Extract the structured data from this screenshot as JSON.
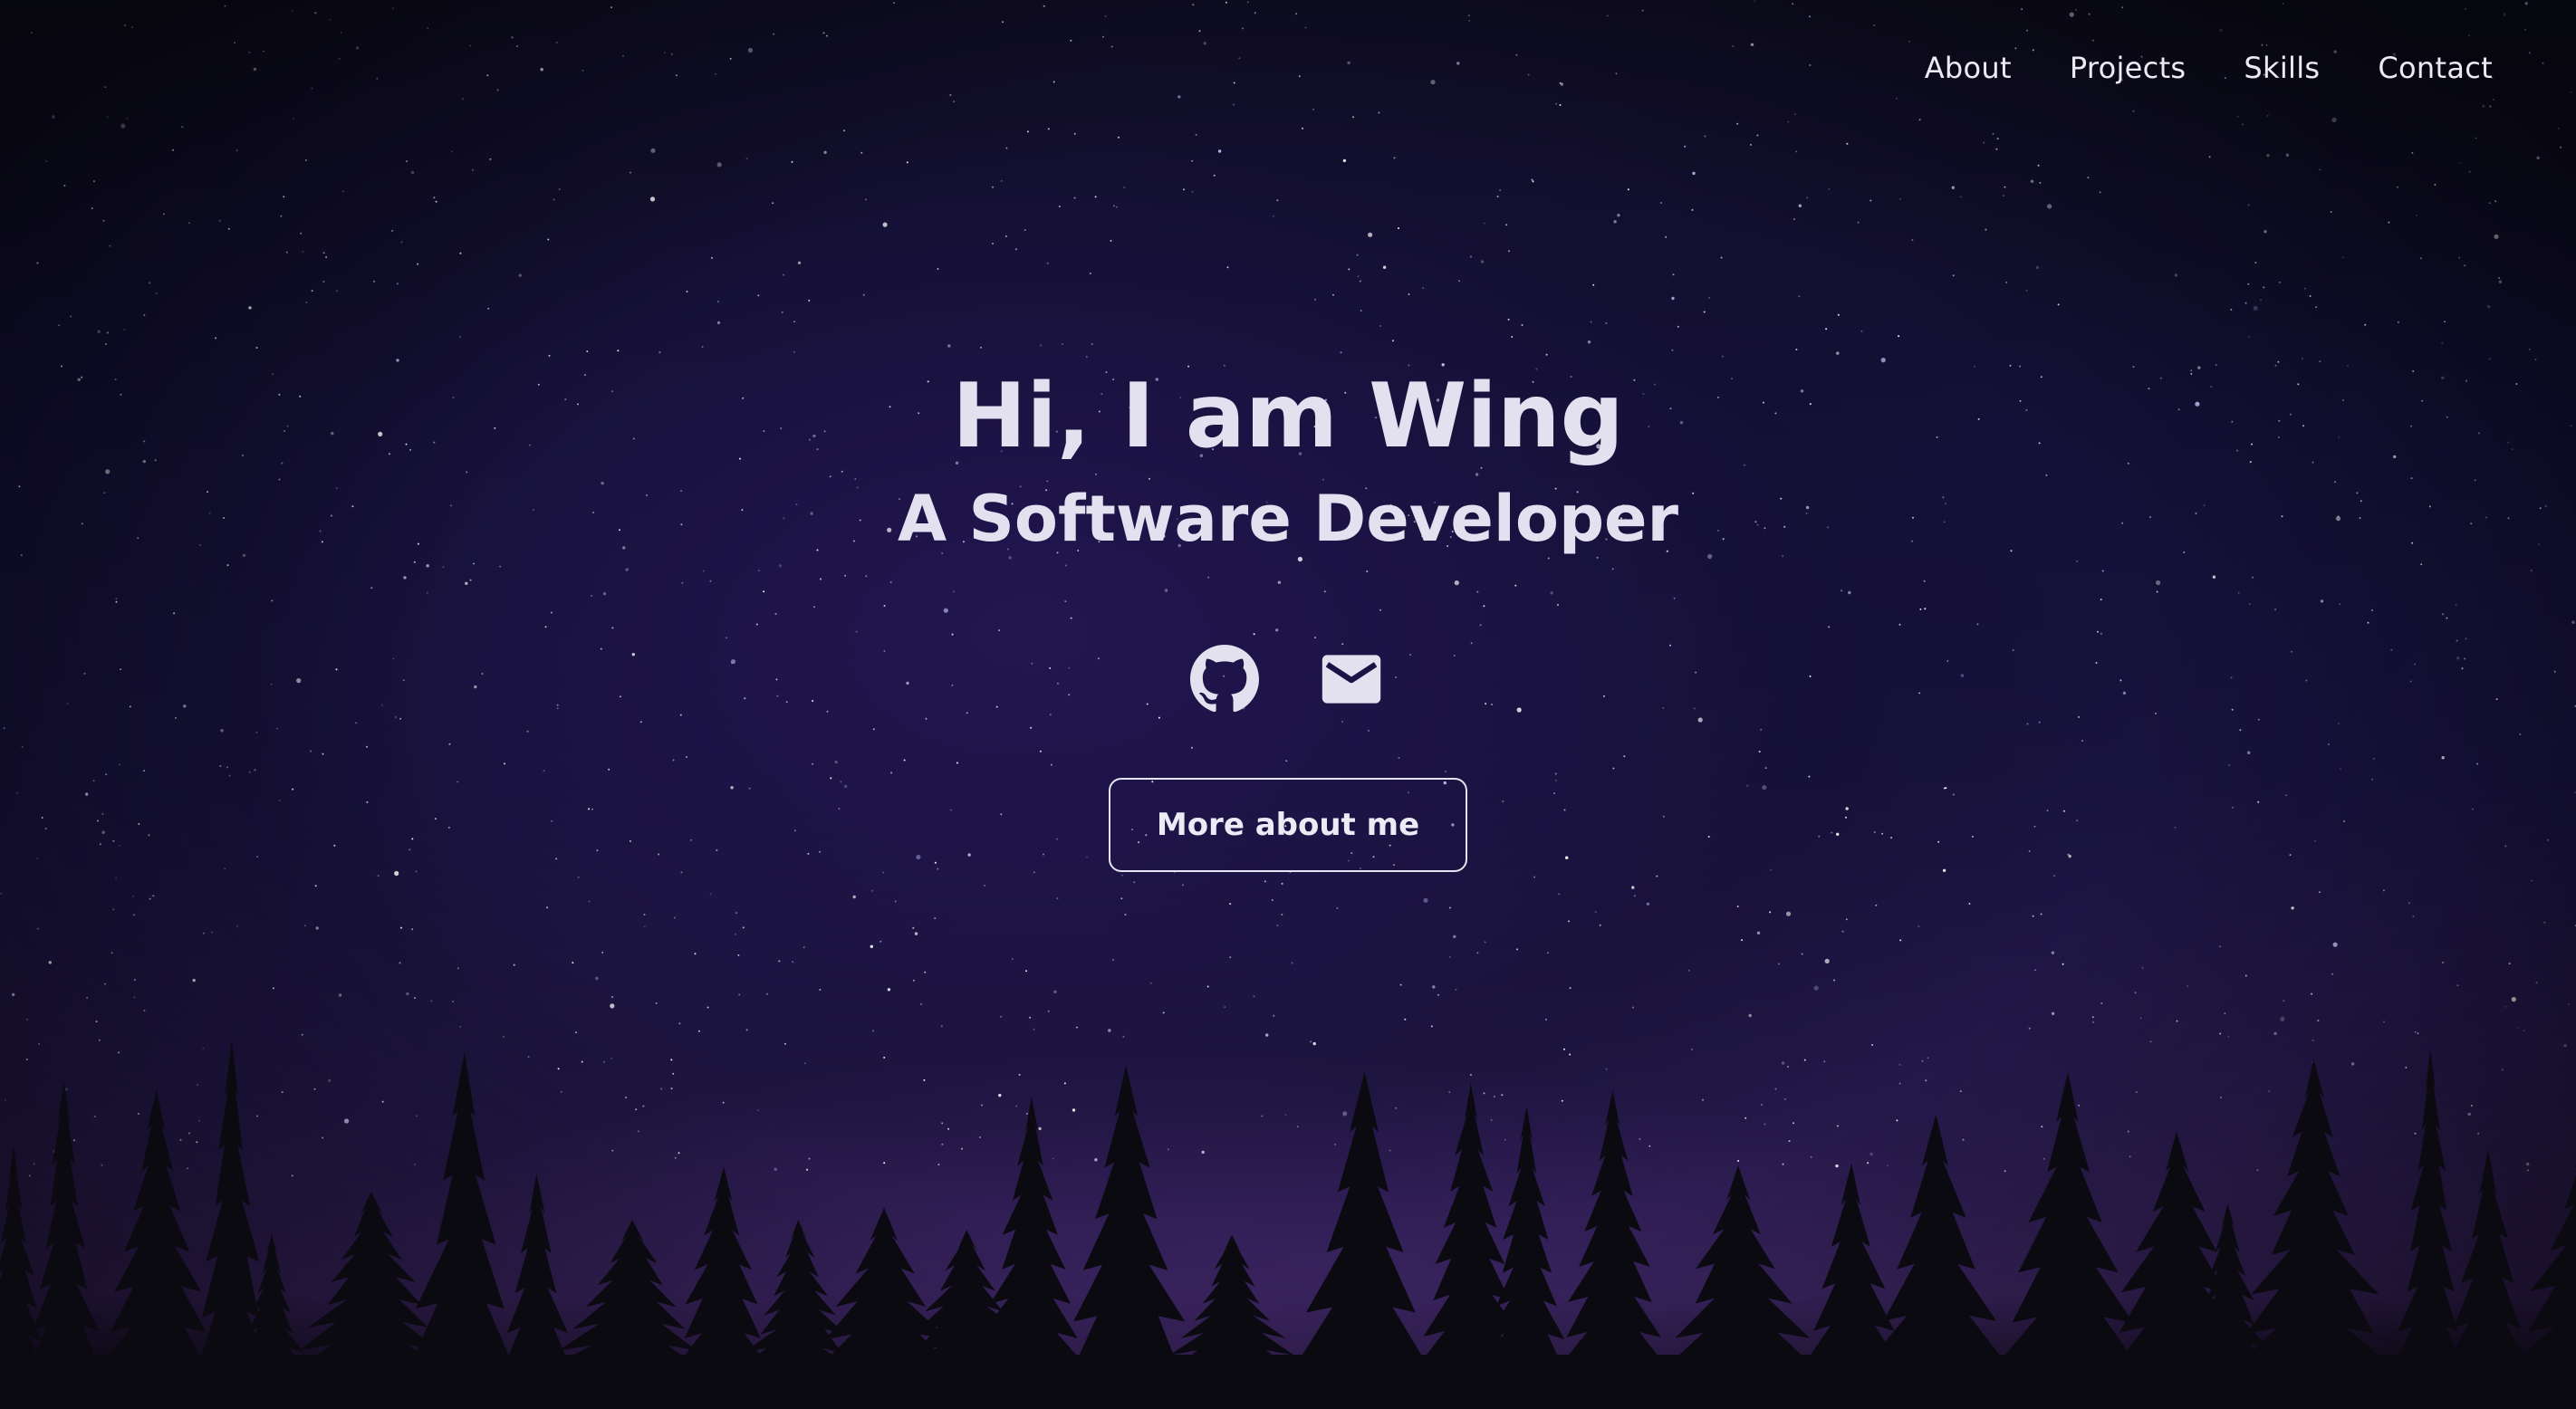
{
  "nav": {
    "items": [
      {
        "label": "About"
      },
      {
        "label": "Projects"
      },
      {
        "label": "Skills"
      },
      {
        "label": "Contact"
      }
    ]
  },
  "hero": {
    "title": "Hi, I am Wing",
    "subtitle": "A Software Developer",
    "socials": [
      {
        "icon": "github-icon"
      },
      {
        "icon": "mail-icon"
      }
    ],
    "cta_label": "More about me"
  },
  "colors": {
    "sky_top": "#0e0d1e",
    "sky_mid": "#1a1444",
    "horizon_glow": "#3a2460",
    "text": "#e3e1f0",
    "tree_silhouette": "#0b0a10"
  }
}
